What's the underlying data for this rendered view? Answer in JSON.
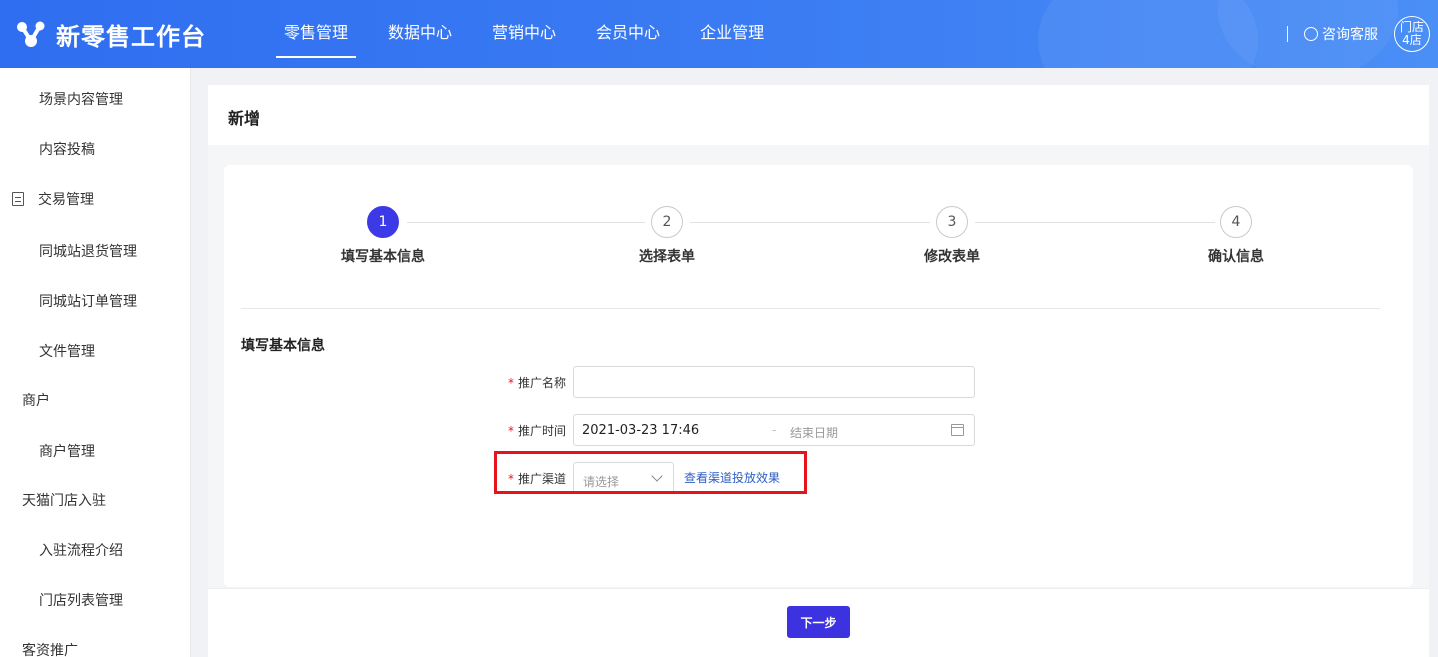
{
  "header": {
    "logo_text": "新零售工作台",
    "nav": [
      "零售管理",
      "数据中心",
      "营销中心",
      "会员中心",
      "企业管理"
    ],
    "active_nav": "零售管理",
    "consult_label": "咨询客服",
    "store_badge": [
      "门店",
      "4店"
    ]
  },
  "sidebar": {
    "items": [
      {
        "label": "场景内容管理"
      },
      {
        "label": "内容投稿"
      },
      {
        "label": "交易管理"
      },
      {
        "label": "同城站退货管理"
      },
      {
        "label": "同城站订单管理"
      },
      {
        "label": "文件管理"
      },
      {
        "label": "商户"
      },
      {
        "label": "商户管理"
      },
      {
        "label": "天猫门店入驻"
      },
      {
        "label": "入驻流程介绍"
      },
      {
        "label": "门店列表管理"
      },
      {
        "label": "客资推广"
      }
    ]
  },
  "page": {
    "title": "新增",
    "steps": [
      {
        "num": "1",
        "label": "填写基本信息"
      },
      {
        "num": "2",
        "label": "选择表单"
      },
      {
        "num": "3",
        "label": "修改表单"
      },
      {
        "num": "4",
        "label": "确认信息"
      }
    ],
    "section_title": "填写基本信息",
    "form": {
      "required_mark": "*",
      "name_label": "推广名称",
      "name_value": "",
      "time_label": "推广时间",
      "start_date": "2021-03-23 17:46",
      "date_separator": "-",
      "end_placeholder": "结束日期",
      "channel_label": "推广渠道",
      "channel_placeholder": "请选择",
      "channel_link": "查看渠道投放效果"
    },
    "next_button": "下一步"
  },
  "colors": {
    "header": "#3b7cf3",
    "primary": "#3c3ae6",
    "highlight": "#e8121a",
    "link": "#2f5ec4"
  },
  "icons": [
    "logo-icon",
    "headset-icon",
    "clipboard-icon",
    "calendar-icon",
    "chevron-down-icon"
  ]
}
